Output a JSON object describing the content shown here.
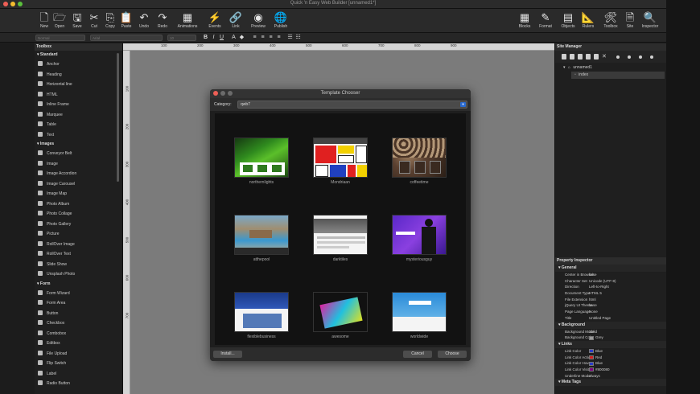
{
  "window": {
    "title": "Quick 'n Easy Web Builder [unnamed1*]"
  },
  "toolbar": {
    "items": [
      {
        "label": "New",
        "icon": "new-file-icon",
        "glyph": "🗋"
      },
      {
        "label": "Open",
        "icon": "open-folder-icon",
        "glyph": "🗁"
      },
      {
        "label": "Save",
        "icon": "save-icon",
        "glyph": "🖫"
      },
      {
        "label": "Cut",
        "icon": "cut-icon",
        "glyph": "✂"
      },
      {
        "label": "Copy",
        "icon": "copy-icon",
        "glyph": "⎘"
      },
      {
        "label": "Paste",
        "icon": "paste-icon",
        "glyph": "📋"
      },
      {
        "label": "Undo",
        "icon": "undo-icon",
        "glyph": "↶"
      },
      {
        "label": "Redo",
        "icon": "redo-icon",
        "glyph": "↷"
      },
      {
        "label": "Animations",
        "icon": "animations-icon",
        "glyph": "▦"
      },
      {
        "label": "Events",
        "icon": "events-icon",
        "glyph": "⚡"
      },
      {
        "label": "Link",
        "icon": "link-icon",
        "glyph": "🔗"
      },
      {
        "label": "Preview",
        "icon": "preview-icon",
        "glyph": "◉"
      },
      {
        "label": "Publish",
        "icon": "publish-icon",
        "glyph": "🌐"
      }
    ],
    "right_items": [
      {
        "label": "Blocks",
        "icon": "blocks-icon",
        "glyph": "▦"
      },
      {
        "label": "Format",
        "icon": "format-icon",
        "glyph": "✎"
      },
      {
        "label": "Objects",
        "icon": "objects-icon",
        "glyph": "▤"
      },
      {
        "label": "Rulers",
        "icon": "rulers-icon",
        "glyph": "📐"
      },
      {
        "label": "Toolbox",
        "icon": "toolbox-icon",
        "glyph": "🛠"
      },
      {
        "label": "Site",
        "icon": "site-icon",
        "glyph": "🗎"
      },
      {
        "label": "Inspector",
        "icon": "inspector-icon",
        "glyph": "🔍"
      }
    ]
  },
  "formatbar": {
    "style_select": "Normal",
    "font_select": "Arial",
    "size_select": "10",
    "buttons": [
      {
        "glyph": "B",
        "icon": "bold-icon"
      },
      {
        "glyph": "I",
        "icon": "italic-icon"
      },
      {
        "glyph": "U",
        "icon": "underline-icon"
      },
      {
        "glyph": "A",
        "icon": "text-color-icon"
      },
      {
        "glyph": "◆",
        "icon": "fill-color-icon"
      },
      {
        "glyph": "≡",
        "icon": "align-left-icon"
      },
      {
        "glyph": "≡",
        "icon": "align-center-icon"
      },
      {
        "glyph": "≡",
        "icon": "align-right-icon"
      },
      {
        "glyph": "≡",
        "icon": "justify-icon"
      },
      {
        "glyph": "☰",
        "icon": "bulleted-list-icon"
      },
      {
        "glyph": "☷",
        "icon": "numbered-list-icon"
      }
    ]
  },
  "toolbox": {
    "title": "Toolbox",
    "sections": [
      {
        "title": "Standard",
        "items": [
          "Anchor",
          "Heading",
          "Horizontal line",
          "HTML",
          "Inline Frame",
          "Marquee",
          "Table",
          "Text"
        ]
      },
      {
        "title": "Images",
        "items": [
          "Conveyor Belt",
          "Image",
          "Image Accordion",
          "Image Carousel",
          "Image Map",
          "Photo Album",
          "Photo Collage",
          "Photo Gallery",
          "Picture",
          "RollOver Image",
          "RollOver Text",
          "Slide Show",
          "Unsplash Photo"
        ]
      },
      {
        "title": "Form",
        "items": [
          "Form Wizard",
          "Form Area",
          "Button",
          "Checkbox",
          "Combobox",
          "Editbox",
          "File Upload",
          "Flip Switch",
          "Label",
          "Radio Button"
        ]
      }
    ]
  },
  "rulers": {
    "h": [
      "100",
      "200",
      "300",
      "400",
      "500",
      "600",
      "700",
      "800",
      "900"
    ],
    "v": [
      "100",
      "200",
      "300",
      "400",
      "500",
      "600",
      "700"
    ]
  },
  "dialog": {
    "title": "Template Chooser",
    "category_label": "Category:",
    "category_value": "qwb7",
    "templates": [
      {
        "name": "northernlights"
      },
      {
        "name": "Mondriaan"
      },
      {
        "name": "coffeetime"
      },
      {
        "name": "atthepool"
      },
      {
        "name": "darktiles"
      },
      {
        "name": "mysteriousguy"
      },
      {
        "name": "flexiblebusiness"
      },
      {
        "name": "awesome"
      },
      {
        "name": "worldwide"
      }
    ],
    "install_label": "Install...",
    "cancel_label": "Cancel",
    "choose_label": "Choose"
  },
  "site_manager": {
    "title": "Site Manager",
    "tree": {
      "root": "unnamed1",
      "child": "index"
    }
  },
  "inspector": {
    "title": "Property Inspector",
    "sections": [
      {
        "title": "General",
        "rows": [
          {
            "key": "Center in Browser",
            "value": "false"
          },
          {
            "key": "Character Set",
            "value": "Unicode (UTF-8)"
          },
          {
            "key": "Direction",
            "value": "Left-to-Right"
          },
          {
            "key": "Document Type",
            "value": "HTML 5"
          },
          {
            "key": "File Extension",
            "value": "html"
          },
          {
            "key": "jQuery UI Theme",
            "value": "base"
          },
          {
            "key": "Page Language",
            "value": "None"
          },
          {
            "key": "Title",
            "value": "Untitled Page"
          }
        ]
      },
      {
        "title": "Background",
        "rows": [
          {
            "key": "Background Mode",
            "value": "Solid"
          },
          {
            "key": "Background Color",
            "value": "Grey",
            "swatch": "#9a9a9a"
          }
        ]
      },
      {
        "title": "Links",
        "rows": [
          {
            "key": "Link Color",
            "value": "Blue",
            "swatch": "#2c3cc8"
          },
          {
            "key": "Link Color Active",
            "value": "Red",
            "swatch": "#d02020"
          },
          {
            "key": "Link Color Hover",
            "value": "Blue",
            "swatch": "#2c3cc8"
          },
          {
            "key": "Link Color Visited",
            "value": "#800080",
            "swatch": "#800080"
          },
          {
            "key": "Underline Mode",
            "value": "always"
          }
        ]
      },
      {
        "title": "Meta Tags",
        "rows": []
      }
    ]
  },
  "colors": {
    "accent": "#2a6ad0",
    "canvas": "#7b7b7b"
  }
}
